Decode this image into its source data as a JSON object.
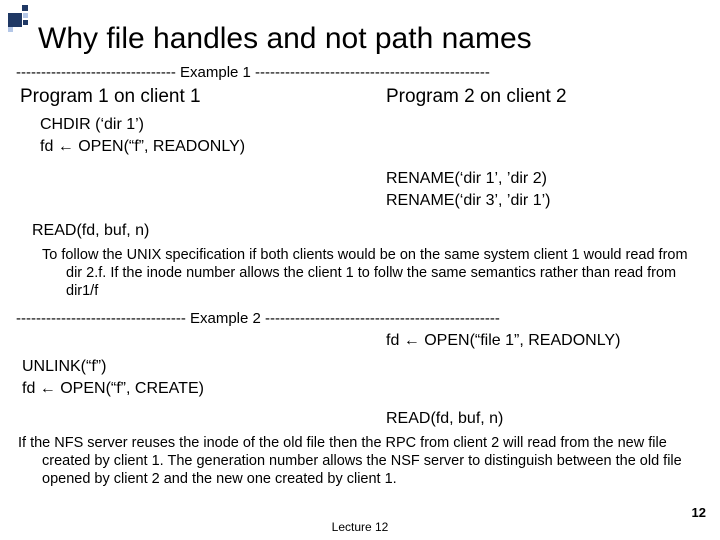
{
  "title": "Why file handles and not path names",
  "divider1": "-------------------------------- Example 1 -----------------------------------------------",
  "program1_label": "Program 1 on client  1",
  "program2_label": "Program 2 on client  2",
  "chdir_line": "CHDIR (‘dir 1’)",
  "fdopen1_line": "fd ← OPEN(“f”, READONLY)",
  "rename1_line": "RENAME(‘dir 1’, ’dir 2)",
  "rename2_line": "RENAME(‘dir 3’, ’dir 1’)",
  "read1_line": "READ(fd, buf, n)",
  "para1": "To follow the UNIX specification if both clients would be on the same system client 1 would read from dir 2.f.  If the inode number allows the client 1 to follw the same semantics rather than read from dir1/f",
  "divider2": "---------------------------------- Example 2 -----------------------------------------------",
  "fdopen2_line": "fd ← OPEN(“file 1”, READONLY)",
  "unlink_line": "UNLINK(“f”)",
  "fdopen3_line": "fd ← OPEN(“f”, CREATE)",
  "read2_line": "READ(fd, buf, n)",
  "para2": "If the NFS server reuses the inode of the old file then the RPC from client 2 will read from the new file created by client 1. The generation number allows the NSF server to distinguish between  the old file opened by  client 2 and the new one created by client 1.",
  "page_number": "12",
  "lecture_label": "Lecture 12"
}
